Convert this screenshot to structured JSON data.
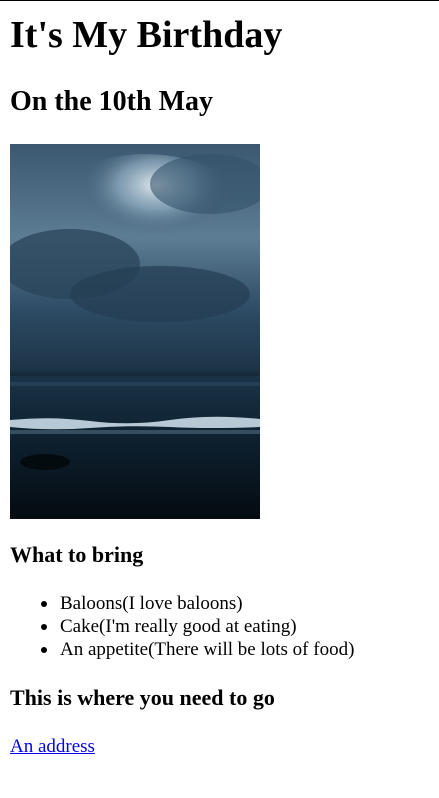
{
  "page": {
    "title": "It's My Birthday",
    "subtitle": "On the 10th May"
  },
  "photo": {
    "alt": "",
    "icon": "sea-and-storm-clouds-photo"
  },
  "bring": {
    "heading": "What to bring",
    "items": [
      "Baloons(I love baloons)",
      "Cake(I'm really good at eating)",
      "An appetite(There will be lots of food)"
    ]
  },
  "location": {
    "heading": "This is where you need to go",
    "link_text": "An address"
  },
  "colors": {
    "link": "#0000ee",
    "text": "#000000",
    "background": "#ffffff"
  }
}
